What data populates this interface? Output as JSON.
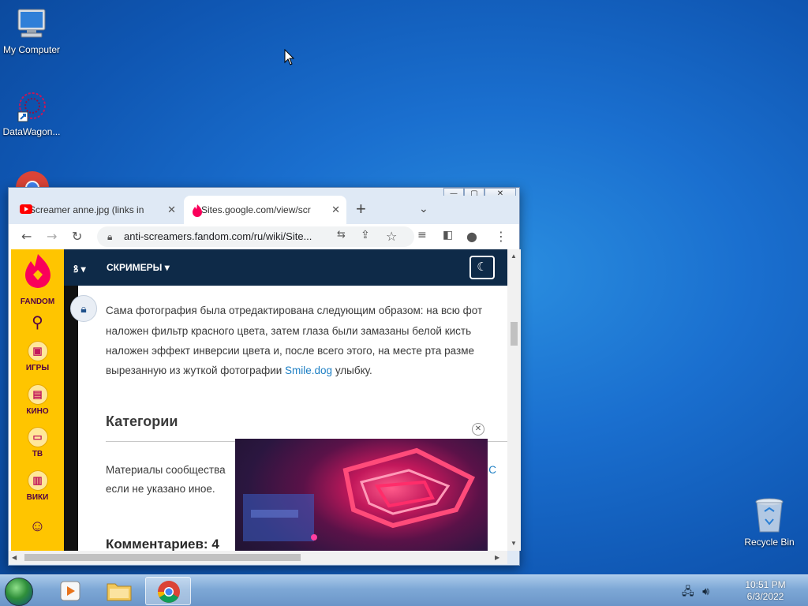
{
  "desktop": {
    "icons": [
      {
        "label": "My Computer",
        "icon": "computer-icon"
      },
      {
        "label": "DataWagon...",
        "icon": "datawagon-icon"
      },
      {
        "label": "Recycle Bin",
        "icon": "recycle-bin-icon"
      }
    ]
  },
  "browser": {
    "tabs": [
      {
        "title": "Screamer anne.jpg (links in",
        "favicon": "youtube-icon",
        "active": false
      },
      {
        "title": "Sites.google.com/view/scr",
        "favicon": "fandom-icon",
        "active": true
      }
    ],
    "address": "anti-screamers.fandom.com/ru/wiki/Site..."
  },
  "fandom": {
    "logo_text": "FANDOM",
    "rail": [
      "ИГРЫ",
      "КИНО",
      "ТВ",
      "ВИКИ"
    ],
    "header_nav": [
      "СКРИМЕРЫ"
    ],
    "wiki_logo": "ꝸ"
  },
  "article": {
    "para1": [
      "Сама фотография была отредактирована следующим образом: на всю фот",
      "наложен фильтр красного цвета, затем глаза были замазаны белой кисть",
      "наложен эффект инверсии цвета и, после всего этого, на месте рта разме",
      "вырезанную из жуткой фотографии "
    ],
    "link_text": "Smile.dog",
    "para1_tail": " улыбку.",
    "categories_heading": "Категории",
    "license_line1_a": "Материалы сообщества",
    "license_line1_b": "и С",
    "license_line2": "если не указано иное.",
    "comments_heading": "Комментариев: 4"
  },
  "taskbar": {
    "time": "10:51 PM",
    "date": "6/3/2022"
  },
  "colors": {
    "fandom_yellow": "#ffc500",
    "fandom_header": "#0e2a48",
    "link": "#1d7fc4"
  }
}
